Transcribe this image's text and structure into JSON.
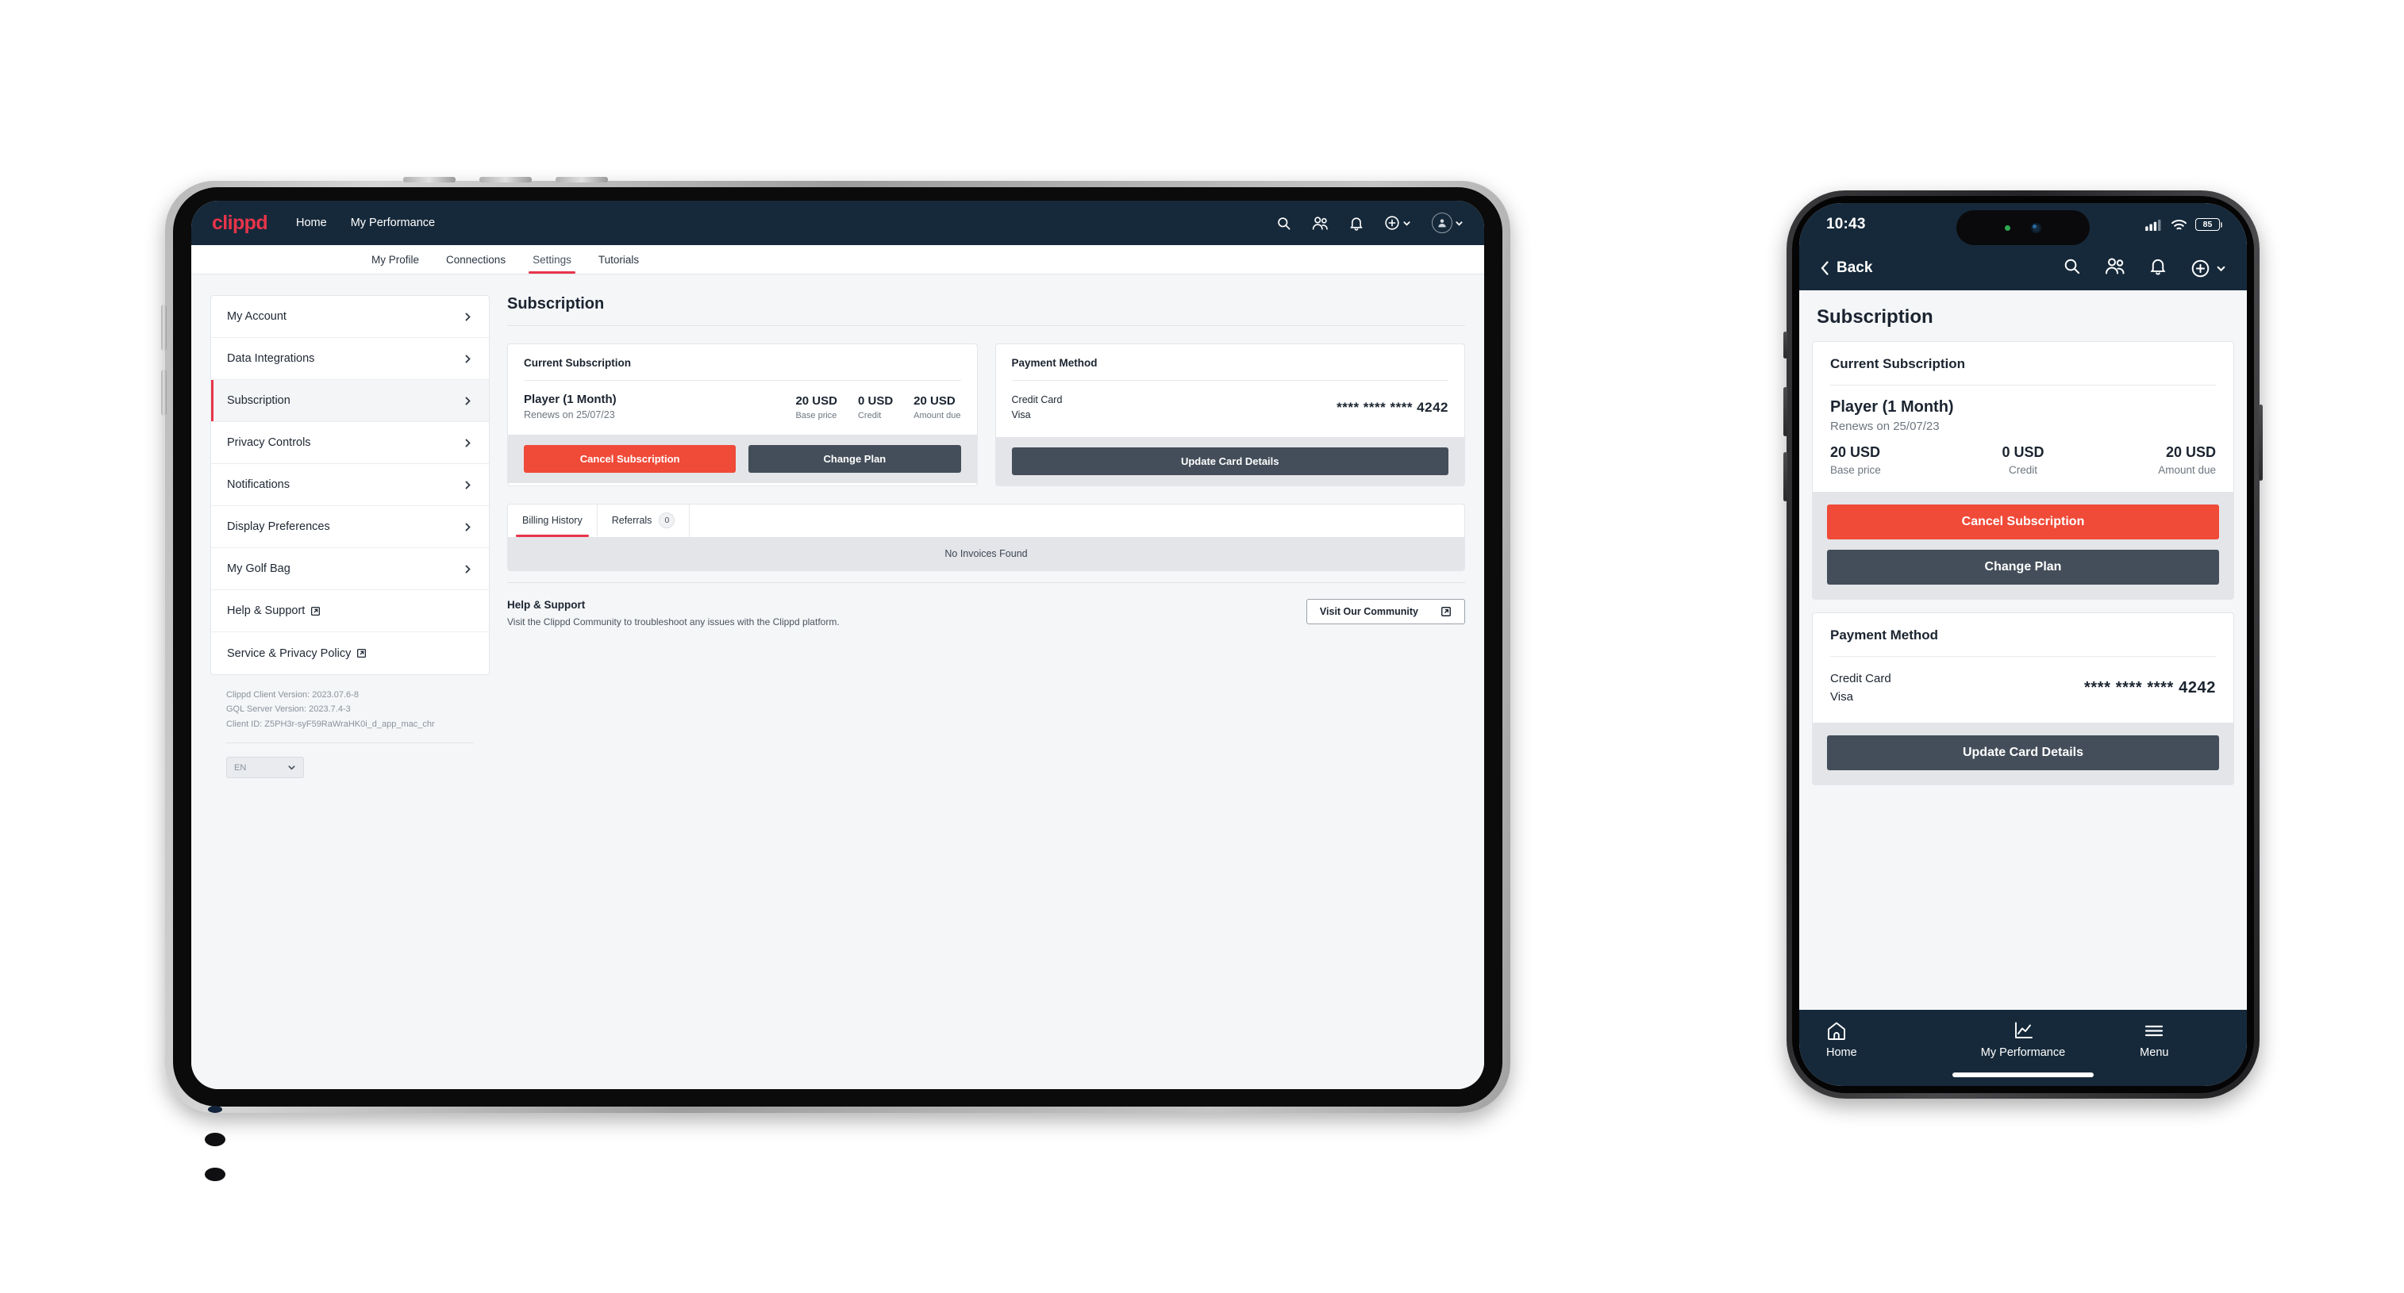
{
  "brand": "clippd",
  "tablet": {
    "nav": {
      "links": [
        {
          "label": "Home"
        },
        {
          "label": "My Performance"
        }
      ],
      "icons": [
        {
          "name": "search-icon"
        },
        {
          "name": "people-icon"
        },
        {
          "name": "bell-icon"
        },
        {
          "name": "plus-circle-icon"
        },
        {
          "name": "avatar-icon"
        }
      ]
    },
    "tabs": [
      {
        "label": "My Profile",
        "active": false
      },
      {
        "label": "Connections",
        "active": false
      },
      {
        "label": "Settings",
        "active": true
      },
      {
        "label": "Tutorials",
        "active": false
      }
    ],
    "sidebar": {
      "items": [
        {
          "label": "My Account",
          "icon": "chevron-right-icon",
          "active": false
        },
        {
          "label": "Data Integrations",
          "icon": "chevron-right-icon",
          "active": false
        },
        {
          "label": "Subscription",
          "icon": "chevron-right-icon",
          "active": true
        },
        {
          "label": "Privacy Controls",
          "icon": "chevron-right-icon",
          "active": false
        },
        {
          "label": "Notifications",
          "icon": "chevron-right-icon",
          "active": false
        },
        {
          "label": "Display Preferences",
          "icon": "chevron-right-icon",
          "active": false
        },
        {
          "label": "My Golf Bag",
          "icon": "chevron-right-icon",
          "active": false
        },
        {
          "label": "Help & Support",
          "icon": "external-link-icon",
          "active": false
        },
        {
          "label": "Service & Privacy Policy",
          "icon": "external-link-icon",
          "active": false
        }
      ],
      "meta": {
        "client_version": "Clippd Client Version: 2023.07.6-8",
        "server_version": "GQL Server Version: 2023.7.4-3",
        "client_id": "Client ID: Z5PH3r-syF59RaWraHK0i_d_app_mac_chr"
      },
      "language": "EN"
    },
    "main": {
      "page_title": "Subscription",
      "current_subscription": {
        "card_title": "Current Subscription",
        "plan_name": "Player (1 Month)",
        "renews": "Renews on 25/07/23",
        "figures": [
          {
            "value": "20 USD",
            "label": "Base price"
          },
          {
            "value": "0 USD",
            "label": "Credit"
          },
          {
            "value": "20 USD",
            "label": "Amount due"
          }
        ],
        "cancel_label": "Cancel Subscription",
        "change_label": "Change Plan"
      },
      "payment_method": {
        "card_title": "Payment Method",
        "type": "Credit Card",
        "brand": "Visa",
        "number": "**** **** **** 4242",
        "update_label": "Update Card Details"
      },
      "billing": {
        "tabs": [
          {
            "label": "Billing History",
            "badge": null,
            "active": true
          },
          {
            "label": "Referrals",
            "badge": "0",
            "active": false
          }
        ],
        "empty_text": "No Invoices Found"
      },
      "help": {
        "title": "Help & Support",
        "subtitle": "Visit the Clippd Community to troubleshoot any issues with the Clippd platform.",
        "button_label": "Visit Our Community"
      }
    }
  },
  "phone": {
    "status": {
      "time": "10:43",
      "battery": "85"
    },
    "topbar": {
      "back_label": "Back",
      "icons": [
        {
          "name": "search-icon"
        },
        {
          "name": "people-icon"
        },
        {
          "name": "bell-icon"
        },
        {
          "name": "plus-circle-icon"
        }
      ]
    },
    "page_title": "Subscription",
    "current_subscription": {
      "card_title": "Current Subscription",
      "plan_name": "Player (1 Month)",
      "renews": "Renews on 25/07/23",
      "figures": [
        {
          "value": "20 USD",
          "label": "Base price"
        },
        {
          "value": "0 USD",
          "label": "Credit"
        },
        {
          "value": "20 USD",
          "label": "Amount due"
        }
      ],
      "cancel_label": "Cancel Subscription",
      "change_label": "Change Plan"
    },
    "payment_method": {
      "card_title": "Payment Method",
      "type": "Credit Card",
      "brand": "Visa",
      "number": "**** **** **** 4242",
      "update_label": "Update Card Details"
    },
    "bottom_nav": [
      {
        "label": "Home",
        "icon": "home-icon"
      },
      {
        "label": "My Performance",
        "icon": "chart-line-icon"
      },
      {
        "label": "Menu",
        "icon": "hamburger-icon"
      }
    ]
  },
  "colors": {
    "navy": "#16293a",
    "brand_red": "#e8344a",
    "danger": "#f04a38",
    "dark_button": "#444e5a",
    "page_bg": "#f4f6f8"
  }
}
